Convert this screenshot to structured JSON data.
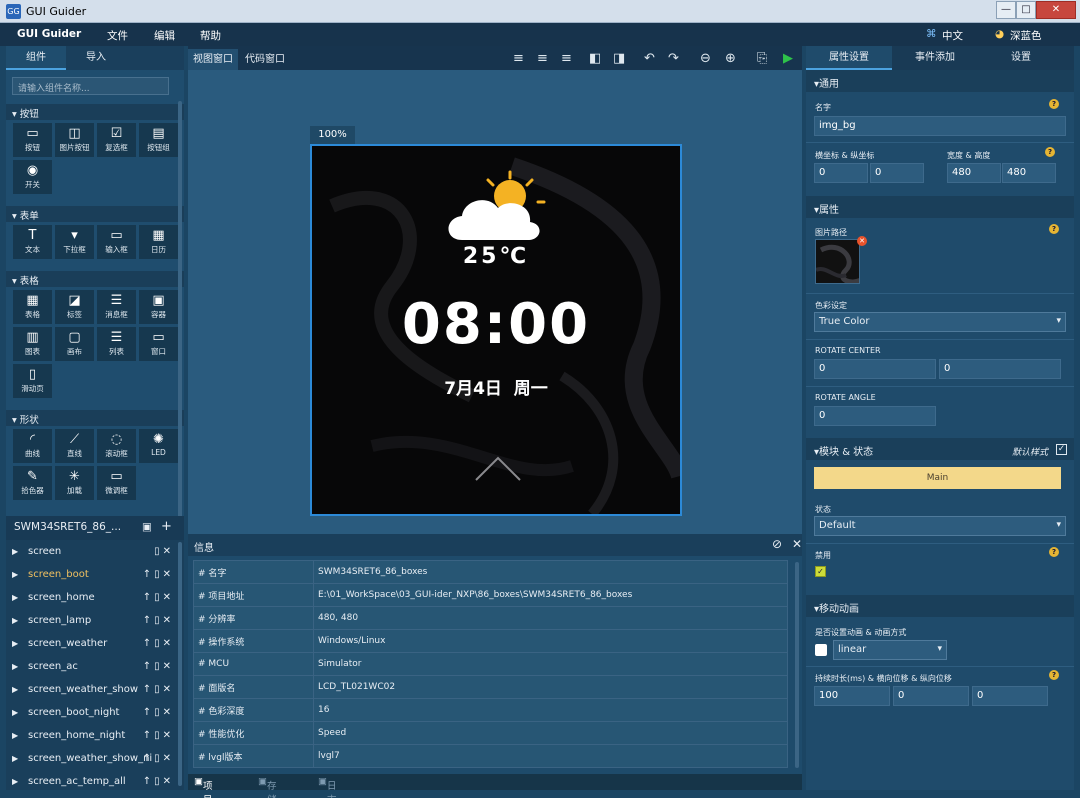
{
  "app": {
    "title": "GUI Guider"
  },
  "window_controls": {
    "minimize": "—",
    "maximize": "□",
    "close": "✕"
  },
  "menu": {
    "brand": "GUI Guider",
    "items": [
      "文件",
      "编辑",
      "帮助"
    ],
    "language": "中文",
    "theme": "深蓝色"
  },
  "left_tabs": [
    "组件",
    "导入"
  ],
  "search": {
    "placeholder": "请输入组件名称..."
  },
  "widget_sections": [
    {
      "title": "按钮",
      "items": [
        {
          "label": "按钮",
          "icon": "button-icon",
          "glyph": "▭"
        },
        {
          "label": "图片按钮",
          "icon": "image-button-icon",
          "glyph": "◫"
        },
        {
          "label": "复选框",
          "icon": "checkbox-icon",
          "glyph": "☑"
        },
        {
          "label": "按钮组",
          "icon": "button-group-icon",
          "glyph": "▤"
        },
        {
          "label": "开关",
          "icon": "switch-icon",
          "glyph": "◉"
        }
      ]
    },
    {
      "title": "表单",
      "items": [
        {
          "label": "文本",
          "icon": "text-icon",
          "glyph": "T"
        },
        {
          "label": "下拉框",
          "icon": "dropdown-icon",
          "glyph": "▾"
        },
        {
          "label": "输入框",
          "icon": "input-box-icon",
          "glyph": "▭"
        },
        {
          "label": "日历",
          "icon": "calendar-icon",
          "glyph": "▦"
        }
      ]
    },
    {
      "title": "表格",
      "items": [
        {
          "label": "表格",
          "icon": "table-icon",
          "glyph": "▦"
        },
        {
          "label": "标签",
          "icon": "tag-icon",
          "glyph": "◪"
        },
        {
          "label": "消息框",
          "icon": "message-box-icon",
          "glyph": "☰"
        },
        {
          "label": "容器",
          "icon": "container-icon",
          "glyph": "▣"
        },
        {
          "label": "图表",
          "icon": "chart-icon",
          "glyph": "▥"
        },
        {
          "label": "画布",
          "icon": "canvas-icon",
          "glyph": "▢"
        },
        {
          "label": "列表",
          "icon": "list-icon",
          "glyph": "☰"
        },
        {
          "label": "窗口",
          "icon": "window-icon",
          "glyph": "▭"
        },
        {
          "label": "滑动页",
          "icon": "slide-page-icon",
          "glyph": "▯"
        }
      ]
    },
    {
      "title": "形状",
      "items": [
        {
          "label": "曲线",
          "icon": "arc-icon",
          "glyph": "◜"
        },
        {
          "label": "直线",
          "icon": "line-icon",
          "glyph": "⟋"
        },
        {
          "label": "滚动框",
          "icon": "roller-icon",
          "glyph": "◌"
        },
        {
          "label": "LED",
          "icon": "led-icon",
          "glyph": "✺"
        },
        {
          "label": "拾色器",
          "icon": "color-picker-icon",
          "glyph": "✎"
        },
        {
          "label": "加载",
          "icon": "spinner-icon",
          "glyph": "✳"
        },
        {
          "label": "微调框",
          "icon": "spinbox-icon",
          "glyph": "▭"
        }
      ]
    }
  ],
  "project": {
    "name": "SWM34SRET6_86_...",
    "screens": [
      {
        "name": "screen",
        "active": false,
        "up": false
      },
      {
        "name": "screen_boot",
        "active": true,
        "up": true
      },
      {
        "name": "screen_home",
        "active": false,
        "up": true
      },
      {
        "name": "screen_lamp",
        "active": false,
        "up": true
      },
      {
        "name": "screen_weather",
        "active": false,
        "up": true
      },
      {
        "name": "screen_ac",
        "active": false,
        "up": true
      },
      {
        "name": "screen_weather_show",
        "active": false,
        "up": true
      },
      {
        "name": "screen_boot_night",
        "active": false,
        "up": true
      },
      {
        "name": "screen_home_night",
        "active": false,
        "up": true
      },
      {
        "name": "screen_weather_show_ni",
        "active": false,
        "up": true
      },
      {
        "name": "screen_ac_temp_all",
        "active": false,
        "up": true
      }
    ]
  },
  "center_tabs": [
    "视图窗口",
    "代码窗口"
  ],
  "zoom": "100%",
  "preview": {
    "temperature": "25℃",
    "time": "08:00",
    "date": "7月4日  周一"
  },
  "info": {
    "title": "信息",
    "rows": [
      {
        "key": "名字",
        "value": "SWM34SRET6_86_boxes"
      },
      {
        "key": "项目地址",
        "value": "E:\\01_WorkSpace\\03_GUI-ider_NXP\\86_boxes\\SWM34SRET6_86_boxes"
      },
      {
        "key": "分辨率",
        "value": "480, 480"
      },
      {
        "key": "操作系统",
        "value": "Windows/Linux"
      },
      {
        "key": "MCU",
        "value": "Simulator"
      },
      {
        "key": "面版名",
        "value": "LCD_TL021WC02"
      },
      {
        "key": "色彩深度",
        "value": "16"
      },
      {
        "key": "性能优化",
        "value": "Speed"
      },
      {
        "key": "lvgl版本",
        "value": "lvgl7"
      }
    ],
    "tabs": [
      "项目参数",
      "存储器",
      "日志"
    ]
  },
  "right_tabs": [
    "属性设置",
    "事件添加",
    "设置"
  ],
  "props": {
    "general_title": "通用",
    "name_label": "名字",
    "name_value": "img_bg",
    "xy_label": "横坐标 & 纵坐标",
    "x": "0",
    "y": "0",
    "wh_label": "宽度 & 高度",
    "w": "480",
    "h": "480",
    "attr_title": "属性",
    "img_path_label": "图片路径",
    "color_label": "色彩设定",
    "color_value": "True Color",
    "rotate_center_label": "ROTATE CENTER",
    "rc_x": "0",
    "rc_y": "0",
    "rotate_angle_label": "ROTATE ANGLE",
    "angle": "0",
    "style_title": "模块 & 状态",
    "default_style": "默认样式",
    "part_value": "Main",
    "state_label": "状态",
    "state_value": "Default",
    "disabled_label": "禁用",
    "anim_title": "移动动画",
    "anim_label": "是否设置动画 & 动画方式",
    "anim_value": "linear",
    "duration_label": "持续时长(ms) & 横向位移 & 纵向位移",
    "duration": "100",
    "dx": "0",
    "dy": "0"
  },
  "colors": {
    "accent_sun": "#f4b223",
    "selected_screen": "#f0c060",
    "part_bar": "#f3d88a"
  }
}
